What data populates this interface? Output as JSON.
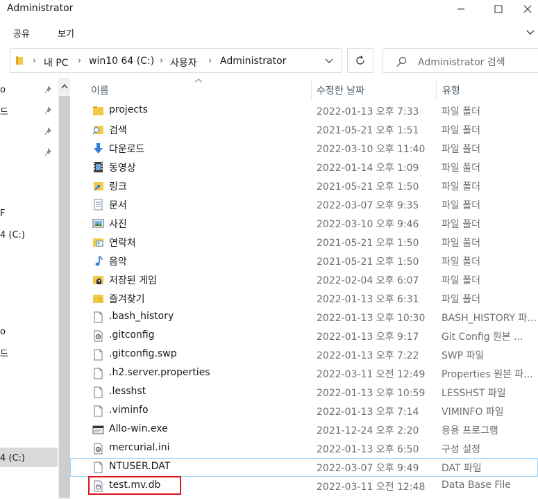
{
  "window": {
    "title": "Administrator"
  },
  "ribbon": {
    "tabs": [
      "공유",
      "보기"
    ]
  },
  "address": {
    "crumbs": [
      "내 PC",
      "win10 64 (C:)",
      "사용자",
      "Administrator"
    ],
    "separator": "›"
  },
  "search": {
    "placeholder": "Administrator 검색"
  },
  "nav": {
    "items": [
      "o",
      "드",
      "",
      "",
      "F",
      "4 (C:)",
      "o",
      "드",
      "4 (C:)"
    ]
  },
  "columns": {
    "name": "이름",
    "date": "수정한 날짜",
    "type": "유형"
  },
  "files": [
    {
      "name": "projects",
      "date": "2022-01-13 오후 7:33",
      "type": "파일 폴더",
      "icon": "folder-icon"
    },
    {
      "name": "검색",
      "date": "2021-05-21 오후 1:51",
      "type": "파일 폴더",
      "icon": "search-folder-icon"
    },
    {
      "name": "다운로드",
      "date": "2022-03-10 오후 11:40",
      "type": "파일 폴더",
      "icon": "download-icon"
    },
    {
      "name": "동영상",
      "date": "2022-01-14 오후 1:09",
      "type": "파일 폴더",
      "icon": "video-icon"
    },
    {
      "name": "링크",
      "date": "2021-05-21 오후 1:50",
      "type": "파일 폴더",
      "icon": "links-folder-icon"
    },
    {
      "name": "문서",
      "date": "2022-03-07 오후 9:35",
      "type": "파일 폴더",
      "icon": "document-icon"
    },
    {
      "name": "사진",
      "date": "2022-03-10 오후 9:46",
      "type": "파일 폴더",
      "icon": "picture-icon"
    },
    {
      "name": "연락처",
      "date": "2021-05-21 오후 1:50",
      "type": "파일 폴더",
      "icon": "contacts-icon"
    },
    {
      "name": "음악",
      "date": "2021-05-21 오후 1:50",
      "type": "파일 폴더",
      "icon": "music-icon"
    },
    {
      "name": "저장된 게임",
      "date": "2022-02-04 오후 6:07",
      "type": "파일 폴더",
      "icon": "saved-games-icon"
    },
    {
      "name": "즐겨찾기",
      "date": "2022-01-13 오후 6:31",
      "type": "파일 폴더",
      "icon": "favorites-icon"
    },
    {
      "name": ".bash_history",
      "date": "2022-01-13 오후 10:30",
      "type": "BASH_HISTORY 파...",
      "icon": "file-icon"
    },
    {
      "name": ".gitconfig",
      "date": "2022-01-13 오후 9:17",
      "type": "Git Config 원본 ...",
      "icon": "gear-file-icon"
    },
    {
      "name": ".gitconfig.swp",
      "date": "2022-01-13 오후 7:22",
      "type": "SWP 파일",
      "icon": "file-icon"
    },
    {
      "name": ".h2.server.properties",
      "date": "2022-03-11 오전 12:49",
      "type": "Properties 원본 파...",
      "icon": "file-icon"
    },
    {
      "name": ".lesshst",
      "date": "2022-01-13 오후 10:59",
      "type": "LESSHST 파일",
      "icon": "file-icon"
    },
    {
      "name": ".viminfo",
      "date": "2022-01-13 오후 7:14",
      "type": "VIMINFO 파일",
      "icon": "file-icon"
    },
    {
      "name": "Allo-win.exe",
      "date": "2021-12-24 오후 2:20",
      "type": "응용 프로그램",
      "icon": "exe-icon"
    },
    {
      "name": "mercurial.ini",
      "date": "2022-01-13 오후 6:50",
      "type": "구성 설정",
      "icon": "gear-file-icon"
    },
    {
      "name": "NTUSER.DAT",
      "date": "2022-03-07 오후 9:49",
      "type": "DAT 파일",
      "icon": "file-icon"
    },
    {
      "name": "test.mv.db",
      "date": "2022-03-11 오전 12:48",
      "type": "Data Base File",
      "icon": "db-file-icon"
    }
  ],
  "colors": {
    "folder": "#f4c94a",
    "highlight": "#e0131f",
    "selection": "#d9d9d9",
    "focus_outline": "#99d1ff"
  }
}
